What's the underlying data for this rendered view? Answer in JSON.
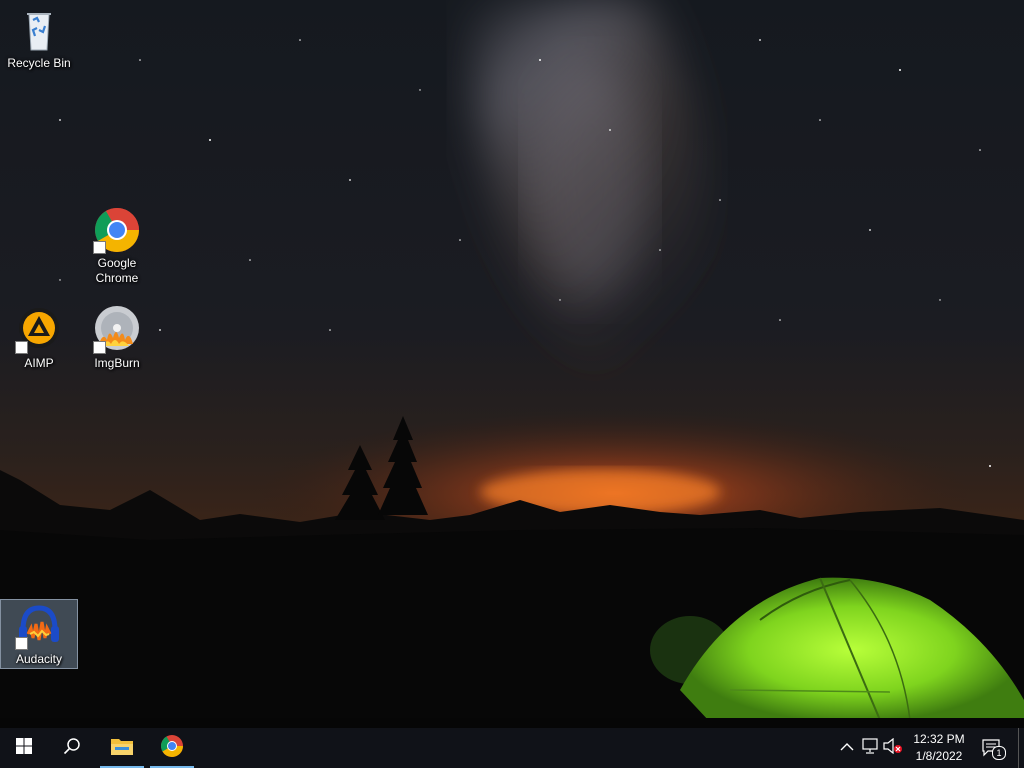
{
  "desktop": {
    "icons": [
      {
        "id": "recycle-bin",
        "label": "Recycle Bin",
        "shortcut": false,
        "selected": false,
        "icon": "recycle-bin-icon"
      },
      {
        "id": "google-chrome",
        "label": "Google Chrome",
        "shortcut": true,
        "selected": false,
        "icon": "chrome-icon"
      },
      {
        "id": "aimp",
        "label": "AIMP",
        "shortcut": true,
        "selected": false,
        "icon": "aimp-icon"
      },
      {
        "id": "imgburn",
        "label": "ImgBurn",
        "shortcut": true,
        "selected": false,
        "icon": "imgburn-icon"
      },
      {
        "id": "audacity",
        "label": "Audacity",
        "shortcut": true,
        "selected": true,
        "icon": "audacity-icon"
      }
    ],
    "wallpaper": {
      "theme": "night sky with milky way, mountain silhouette and glowing green tent"
    }
  },
  "taskbar": {
    "start_icon": "windows-logo-icon",
    "search_icon": "search-icon",
    "pinned": [
      {
        "name": "File Explorer",
        "icon": "folder-icon",
        "running": true
      },
      {
        "name": "Google Chrome",
        "icon": "chrome-icon",
        "running": true
      }
    ],
    "tray": {
      "icons": [
        "chevron-up-icon",
        "network-icon",
        "volume-muted-icon"
      ],
      "time": "12:32 PM",
      "date": "1/8/2022",
      "notification_count": "1"
    }
  },
  "colors": {
    "taskbar": "#101218",
    "accent": "#76b9ed",
    "tent": "#8de024",
    "horizon": "#e8611a"
  }
}
